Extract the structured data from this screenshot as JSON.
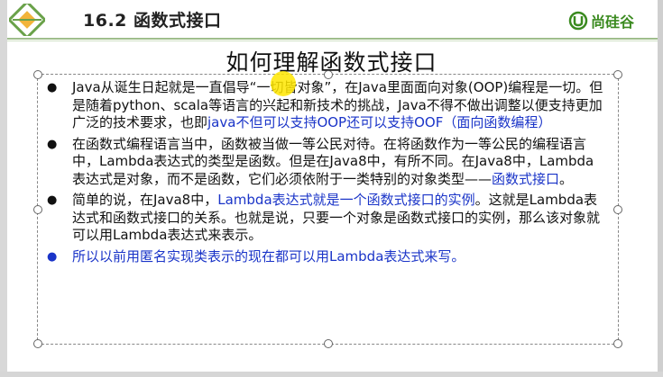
{
  "header": {
    "title": "16.2 函数式接口",
    "brand": "尚硅谷"
  },
  "slide": {
    "title": "如何理解函数式接口",
    "bullets": [
      {
        "parts": [
          {
            "text": "Java从诞生日起就是一直倡导“一切皆对象”，在Java里面面向对象(OOP)编程是一切。但是随着python、scala等语言的兴起和新技术的挑战，Java不得不做出调整以便支持更加广泛的技术要求，也即",
            "hl": false
          },
          {
            "text": "java不但可以支持OOP还可以支持OOF（面向函数编程）",
            "hl": true
          }
        ]
      },
      {
        "parts": [
          {
            "text": "在函数式编程语言当中，函数被当做一等公民对待。在将函数作为一等公民的编程语言中，Lambda表达式的类型是函数。但是在Java8中，有所不同。在Java8中，Lambda表达式是对象，而不是函数，它们必须依附于一类特别的对象类型——",
            "hl": false
          },
          {
            "text": "函数式接口",
            "hl": true
          },
          {
            "text": "。",
            "hl": false
          }
        ]
      },
      {
        "parts": [
          {
            "text": "简单的说，在Java8中，",
            "hl": false
          },
          {
            "text": "Lambda表达式就是一个函数式接口的实例",
            "hl": true
          },
          {
            "text": "。这就是Lambda表达式和函数式接口的关系。也就是说，只要一个对象是函数式接口的实例，那么该对象就可以用Lambda表达式来表示。",
            "hl": false
          }
        ]
      },
      {
        "parts": [
          {
            "text": "所以以前用匿名实现类表示的现在都可以用Lambda表达式来写。",
            "hl": true
          }
        ]
      }
    ],
    "bullet_glyph": "●"
  },
  "colors": {
    "highlight": "#1a34c8",
    "brand": "#3a8a1f"
  }
}
